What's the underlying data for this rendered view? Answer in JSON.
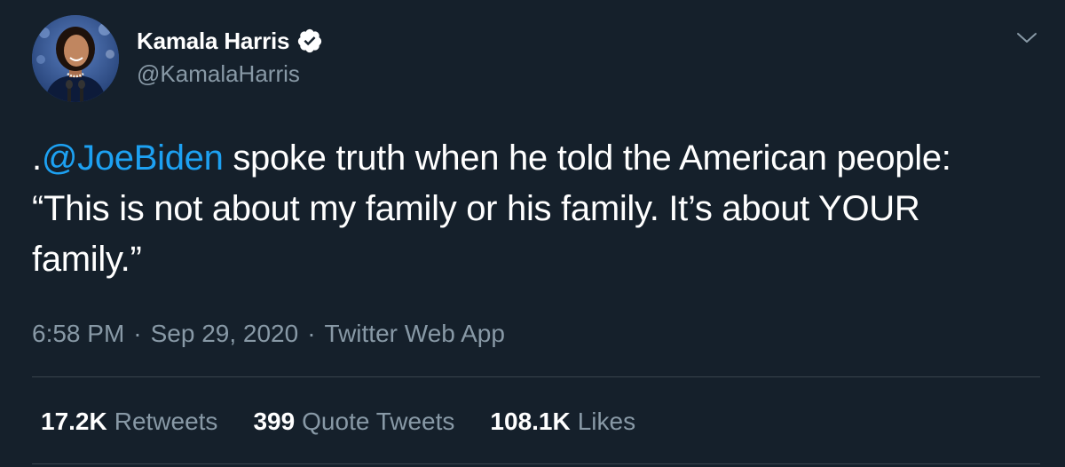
{
  "author": {
    "display_name": "Kamala Harris",
    "handle": "@KamalaHarris",
    "verified": true
  },
  "tweet": {
    "prefix": ".",
    "mention": "@JoeBiden",
    "body": " spoke truth when he told the American people: “This is not about my family or his family. It’s about YOUR family.”"
  },
  "meta": {
    "time": "6:58 PM",
    "separator": "·",
    "date": "Sep 29, 2020",
    "source": "Twitter Web App"
  },
  "stats": [
    {
      "count": "17.2K",
      "label": "Retweets"
    },
    {
      "count": "399",
      "label": "Quote Tweets"
    },
    {
      "count": "108.1K",
      "label": "Likes"
    }
  ],
  "colors": {
    "background": "#15202b",
    "accent": "#1da1f2",
    "secondary_text": "#8899a6",
    "divider": "#38444d"
  },
  "icons": {
    "verified": "verified-badge-icon",
    "menu": "chevron-down-icon"
  }
}
